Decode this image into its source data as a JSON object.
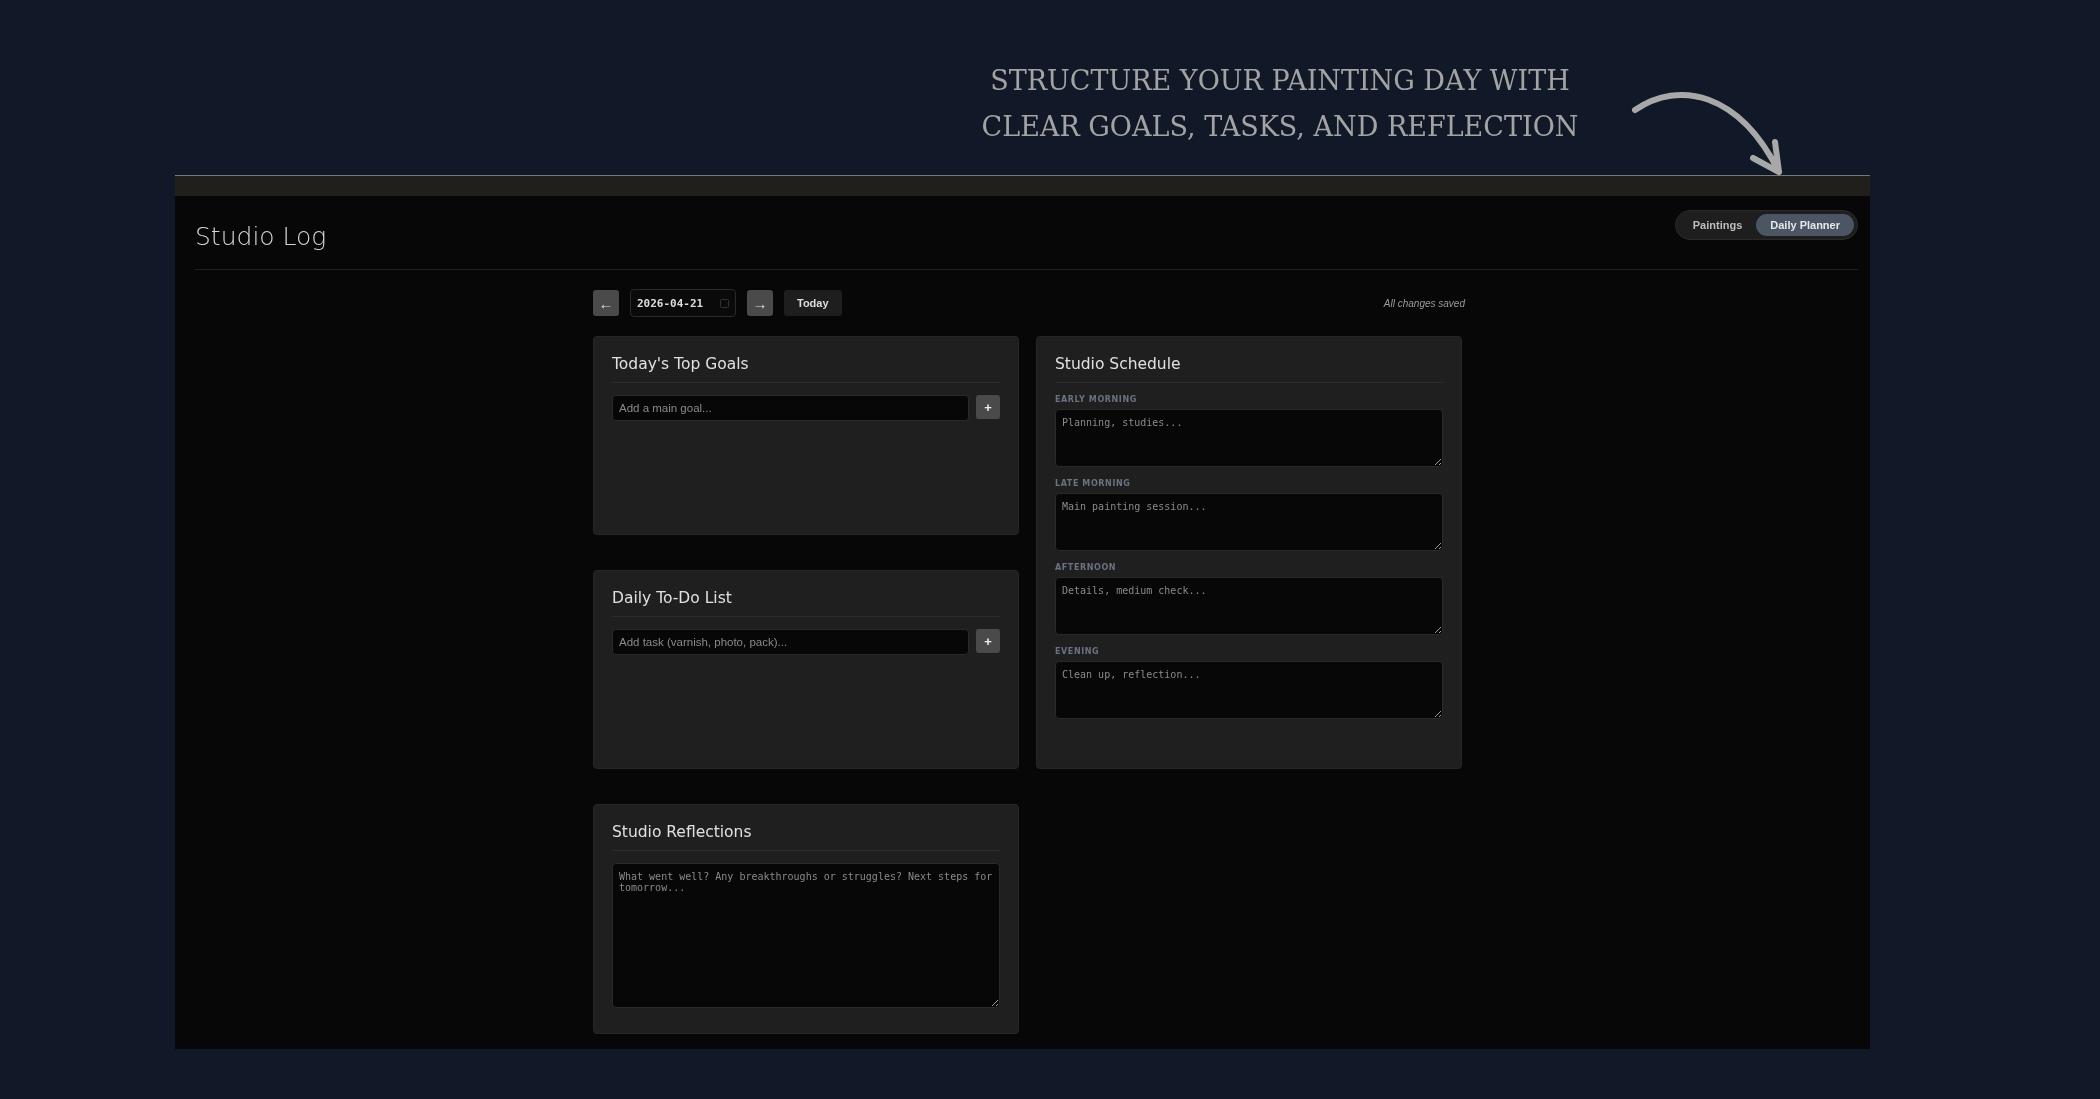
{
  "headline": {
    "lines": [
      "STRUCTURE YOUR PAINTING DAY WITH",
      "CLEAR GOALS, TASKS, AND REFLECTION"
    ]
  },
  "app": {
    "title": "Studio Log",
    "views": [
      {
        "label": "Paintings",
        "selected": false
      },
      {
        "label": "Daily Planner",
        "selected": true
      }
    ],
    "date_nav": {
      "prev": "←",
      "date": "2026-04-21",
      "next": "→",
      "today": "Today",
      "status": "All changes saved"
    },
    "goals": {
      "title": "Today's Top Goals",
      "placeholder": "Add a main goal...",
      "add": "+"
    },
    "todo": {
      "title": "Daily To-Do List",
      "placeholder": "Add task (varnish, photo, pack)...",
      "add": "+"
    },
    "reflections": {
      "title": "Studio Reflections",
      "placeholder": "What went well? Any breakthroughs or struggles? Next steps for tomorrow..."
    },
    "schedule": {
      "title": "Studio Schedule",
      "slots": [
        {
          "label": "EARLY MORNING",
          "placeholder": "Planning, studies..."
        },
        {
          "label": "LATE MORNING",
          "placeholder": "Main painting session..."
        },
        {
          "label": "AFTERNOON",
          "placeholder": "Details, medium check..."
        },
        {
          "label": "EVENING",
          "placeholder": "Clean up, reflection..."
        }
      ]
    }
  }
}
